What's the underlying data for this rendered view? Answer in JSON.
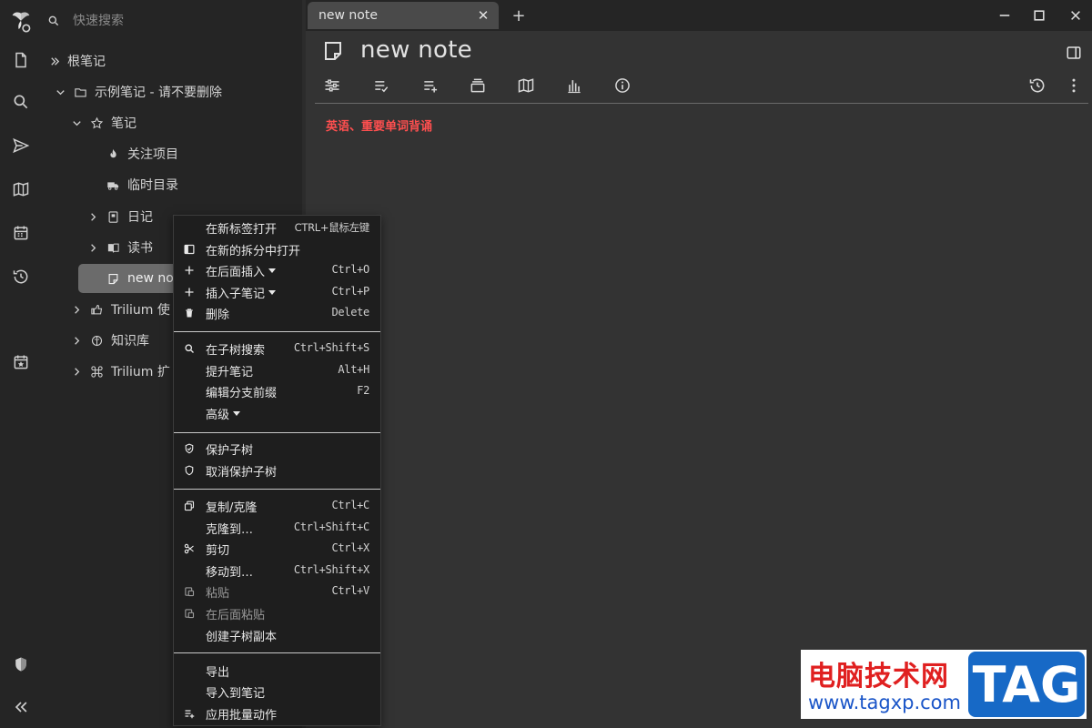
{
  "search": {
    "placeholder": "快速搜索"
  },
  "tree": {
    "root": "根笔记",
    "demo": "示例笔记 - 请不要删除",
    "notes": "笔记",
    "watch": "关注项目",
    "temp": "临时目录",
    "diary": "日记",
    "books": "读书",
    "new_note": "new no",
    "trilium_use": "Trilium 使",
    "knowledge": "知识库",
    "trilium_ext": "Trilium 扩"
  },
  "tabs": {
    "active": "new note",
    "new_tab": "+"
  },
  "note": {
    "title": "new note",
    "content": "英语、重要单词背诵"
  },
  "context_menu": {
    "open_new_tab": {
      "label": "在新标签打开",
      "key": "CTRL+鼠标左键"
    },
    "open_split": {
      "label": "在新的拆分中打开"
    },
    "insert_after": {
      "label": "在后面插入",
      "key": "Ctrl+O"
    },
    "insert_child": {
      "label": "插入子笔记",
      "key": "Ctrl+P"
    },
    "delete": {
      "label": "删除",
      "key": "Delete"
    },
    "search_subtree": {
      "label": "在子树搜索",
      "key": "Ctrl+Shift+S"
    },
    "promote": {
      "label": "提升笔记",
      "key": "Alt+H"
    },
    "edit_prefix": {
      "label": "编辑分支前缀",
      "key": "F2"
    },
    "advanced": {
      "label": "高级"
    },
    "protect": {
      "label": "保护子树"
    },
    "unprotect": {
      "label": "取消保护子树"
    },
    "copy_clone": {
      "label": "复制/克隆",
      "key": "Ctrl+C"
    },
    "clone_to": {
      "label": "克隆到…",
      "key": "Ctrl+Shift+C"
    },
    "cut": {
      "label": "剪切",
      "key": "Ctrl+X"
    },
    "move_to": {
      "label": "移动到…",
      "key": "Ctrl+Shift+X"
    },
    "paste": {
      "label": "粘贴",
      "key": "Ctrl+V"
    },
    "paste_after": {
      "label": "在后面粘贴"
    },
    "duplicate": {
      "label": "创建子树副本"
    },
    "export": {
      "label": "导出"
    },
    "import": {
      "label": "导入到笔记"
    },
    "bulk": {
      "label": "应用批量动作"
    }
  },
  "watermark": {
    "cn": "电脑技术网",
    "url": "www.tagxp.com",
    "tag": "TAG"
  },
  "colors": {
    "accent_text": "#ff4f4f",
    "panel": "#252525",
    "main": "#333333"
  }
}
